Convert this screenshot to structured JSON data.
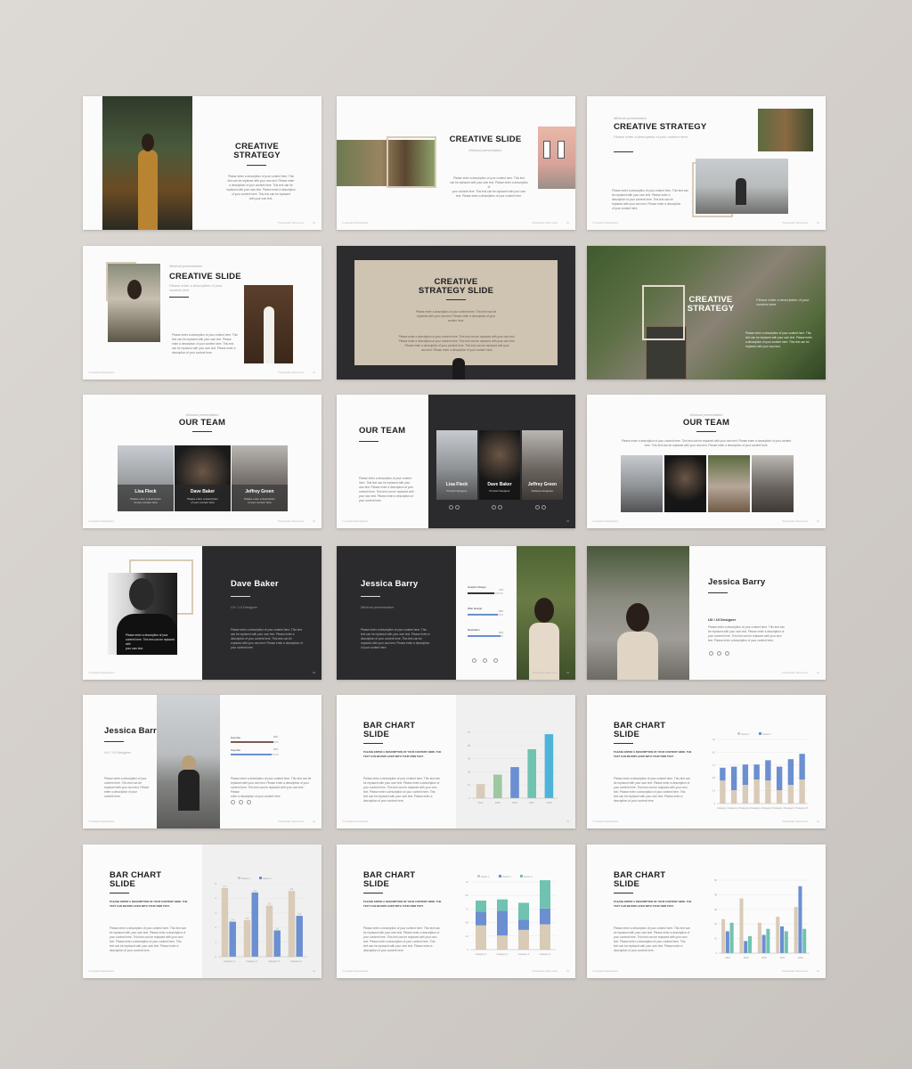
{
  "colors": {
    "accent_blue": "#6b8fd0",
    "accent_beige": "#d9cbb7",
    "accent_teal": "#6fc3b0",
    "accent_green": "#9fc7a0",
    "accent_cyan": "#4fb3d8",
    "dark": "#2b2b2d"
  },
  "footer": {
    "left": "© example Presentations",
    "right": "Presentation Name Here",
    "page": "01"
  },
  "s1": {
    "title": "CREATIVE\nSTRATEGY",
    "body": "Please enter a description of your content here. This\ntext can be replaced with your own text. Please enter\na description of your content here. This text can be\nreplaced with your own text. Please enter a description\nof your content here. This text can be replaced\nwith your own text."
  },
  "s2": {
    "title": "CREATIVE SLIDE",
    "sub": "Minimal presentation",
    "body": "Please enter a description of your content here. This text\ncan be replaced with your own text. Please enter a description of\nyour content here. This text can be replaced with your own\ntext. Please enter a description of your content here."
  },
  "s3": {
    "sub_top": "Minimal presentation",
    "title": "CREATIVE STRATEGY",
    "sub": "Please enter a description of your content here",
    "body": "Please enter a description of your content here. This text can\nbe replaced with your own text. Please enter a\ndescription of your content here. This text can be\nreplaced with your own text. Please enter a description\nof your content here."
  },
  "s4": {
    "sub_top": "Minimal presentation",
    "title": "CREATIVE SLIDE",
    "sub": "Please enter a description of your\ncontent here",
    "body": "Please enter a description of your content here. This\ntext can be replaced with your own text. Please\nenter a description of your content here. This text\ncan be replaced with your own text. Please enter a\ndescription of your content here."
  },
  "s5": {
    "title": "CREATIVE\nSTRATEGY SLIDE",
    "sub": "Please enter a description of your content here. This text can be\nreplaced with your own text. Please enter a description of your\ncontent here.",
    "body": "Please enter a description of your content here. This text can be replaced with your own text.\nPlease enter a description of your content here. This text can be replaced with your own text.\nPlease enter a description of your content here. This text can be replaced with your\nown text. Please enter a description of your content here."
  },
  "s6": {
    "title": "CREATIVE\nSTRATEGY",
    "sub": "Please enter a description of your content here",
    "body": "Please enter a description of your content here. This\ntext can be replaced with your own text. Please enter\na description of your content here. This text can be\nreplaced with your own text."
  },
  "s7": {
    "sub_top": "Minimal presentation",
    "title": "OUR TEAM",
    "members": [
      {
        "name": "Lisa Fleck",
        "desc": "Please enter a description\nof your content here"
      },
      {
        "name": "Dave Baker",
        "desc": "Please enter a description\nof your content here"
      },
      {
        "name": "Jeffrey Green",
        "desc": "Please enter a description\nof your content here"
      }
    ]
  },
  "s8": {
    "title": "OUR TEAM",
    "body": "Please enter a description of your content\nhere. This text can be replaced with your\nown text. Please enter a description of your\ncontent here. This text can be replaced with\nyour own text. Please enter a description of\nyour content here.",
    "members": [
      {
        "name": "Lisa Fleck",
        "role": "Product Designer"
      },
      {
        "name": "Dave Baker",
        "role": "Product Designer"
      },
      {
        "name": "Jeffrey Green",
        "role": "Software Engineer"
      }
    ]
  },
  "s9": {
    "sub_top": "Minimal presentation",
    "title": "OUR TEAM",
    "body": "Please enter a description of your content here. This text can be replaced with your own text. Please enter a description of your content\nhere. This text can be replaced with your own text. Please enter a description of your content here."
  },
  "s10": {
    "title": "Dave Baker",
    "sub": "UX / UI Designer",
    "photo_text": "Please enter a description of your\ncontent here. This text can be replaced with\nyour own text.",
    "body": "Please enter a description of your content here. This text\ncan be replaced with your own text. Please enter a\ndescription of your content here. This text can be\nreplaced with your own text. Please enter a description of\nyour content here."
  },
  "s11": {
    "title": "Jessica Barry",
    "sub": "Minimal presentation",
    "body": "Please enter a description of your content here. This\ntext can be replaced with your own text. Please enter a\ndescription of your content here. This text can be\nreplaced with your own text. Please enter a description\nof your content here.",
    "skills": [
      {
        "label": "Graphic Design",
        "value": "74%",
        "level": 0.74
      },
      {
        "label": "Web Design",
        "value": "86%",
        "level": 0.86
      },
      {
        "label": "Illustration",
        "value": "92%",
        "level": 0.92
      }
    ]
  },
  "s12": {
    "title": "Jessica Barry",
    "sub": "UX / UI Designer",
    "body": "Please enter a description of your content here. This text can\nbe replaced with your own text. Please enter a description of\nyour content here. This text can be replaced with your own\ntext. Please enter a description of your content here."
  },
  "s13": {
    "title": "Jessica Barry",
    "sub": "UX / UI Designer",
    "body_left": "Please enter a description of your\ncontent here. This text can be\nreplaced with your own text. Please\nenter a description of your\ncontent here.",
    "body_right": "Please enter a description of your content here. This text can be\nreplaced with your own text. Please enter a description of your\ncontent here. This text can be replaced with your own text. Please\nenter a description of your content here.",
    "skills": [
      {
        "label": "Keynote",
        "value": "88%",
        "level": 0.88
      },
      {
        "label": "Keynote",
        "value": "86%",
        "level": 0.86
      }
    ]
  },
  "bar_slides": {
    "title": "BAR CHART\nSLIDE",
    "caps": "PLEASE ENTER A DESCRIPTION OF YOUR CONTENT HERE. THE\nTEXT CAN BE REPLACED WITH YOUR OWN TEXT.",
    "body": "Please enter a description of your content here. This text can\nbe replaced with your own text. Please enter a description of\nyour content here. This text can be replaced with your own\ntext. Please enter a description of your content here. This\ntext can be replaced with your own text. Please enter a\ndescription of your content here."
  },
  "chart_data": [
    {
      "type": "bar",
      "categories": [
        "2014",
        "2015",
        "2016",
        "2017",
        "2018"
      ],
      "values": [
        15,
        25,
        33,
        52,
        68
      ],
      "ylim": [
        0,
        70
      ],
      "colors": [
        "#d9cbb7",
        "#9fc7a0",
        "#6b8fd0",
        "#6fc3b0",
        "#4fb3d8"
      ]
    },
    {
      "type": "bar",
      "categories": [
        "Category 1",
        "Category 2",
        "Category 3",
        "Category 4",
        "Category 5",
        "Category 6",
        "Category 7",
        "Category 8"
      ],
      "legend": [
        "Series 1",
        "Series 2"
      ],
      "series": [
        {
          "name": "Series 1",
          "values": [
            4.3,
            2.5,
            3.5,
            4.5,
            4.3,
            2.5,
            3.5,
            4.5
          ]
        },
        {
          "name": "Series 2",
          "values": [
            2.4,
            4.4,
            3.8,
            2.8,
            3.8,
            4.4,
            4.8,
            4.8
          ]
        }
      ],
      "stacked": true,
      "ylim": [
        0,
        12
      ]
    },
    {
      "type": "bar",
      "categories": [
        "Category 1",
        "Category 2",
        "Category 3",
        "Category 4"
      ],
      "legend": [
        "Series 1",
        "Series 2"
      ],
      "series": [
        {
          "name": "Series 1",
          "values": [
            4.7,
            2.5,
            3.5,
            4.5
          ]
        },
        {
          "name": "Series 2",
          "values": [
            2.4,
            4.4,
            1.8,
            2.8
          ]
        }
      ],
      "data_labels": [
        "4.7",
        "2.4",
        "2.5",
        "4.4",
        "3.5",
        "1.8",
        "4.5",
        "2.8"
      ],
      "ylim": [
        0,
        5
      ]
    },
    {
      "type": "bar",
      "categories": [
        "Category 1",
        "Category 2",
        "Category 3",
        "Category 4"
      ],
      "legend": [
        "Series 1",
        "Series 2",
        "Series 3"
      ],
      "series": [
        {
          "name": "Series 1",
          "values": [
            4.3,
            2.5,
            3.5,
            4.5
          ]
        },
        {
          "name": "Series 2",
          "values": [
            2.4,
            4.4,
            1.8,
            2.8
          ]
        },
        {
          "name": "Series 3",
          "values": [
            2,
            2,
            3,
            5
          ]
        }
      ],
      "stacked": true,
      "ylim": [
        0,
        12
      ]
    },
    {
      "type": "bar",
      "categories": [
        "2014",
        "2015",
        "2016",
        "2017",
        "2018"
      ],
      "series": [
        {
          "name": "A",
          "values": [
            28,
            45,
            25,
            30,
            38
          ]
        },
        {
          "name": "B",
          "values": [
            18,
            10,
            15,
            22,
            55
          ]
        },
        {
          "name": "C",
          "values": [
            25,
            14,
            20,
            18,
            20
          ]
        }
      ],
      "ylim": [
        0,
        60
      ]
    }
  ]
}
